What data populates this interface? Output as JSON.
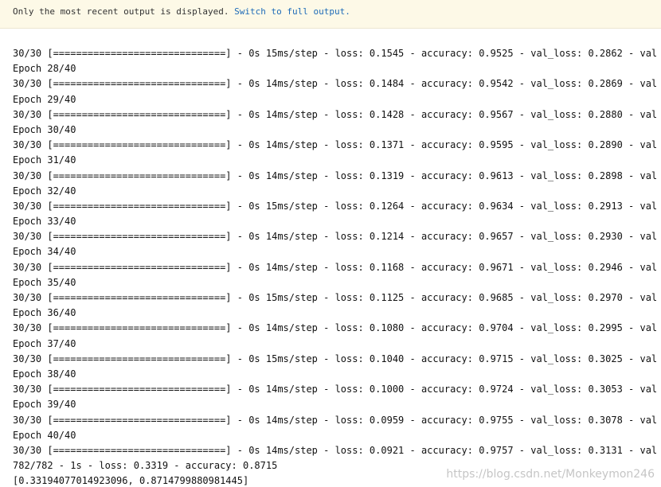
{
  "notice": {
    "text": "Only the most recent output is displayed.",
    "link": "Switch to full output."
  },
  "output": {
    "lines": [
      "30/30 [==============================] - 0s 15ms/step - loss: 0.1545 - accuracy: 0.9525 - val_loss: 0.2862 - val",
      "Epoch 28/40",
      "30/30 [==============================] - 0s 14ms/step - loss: 0.1484 - accuracy: 0.9542 - val_loss: 0.2869 - val",
      "Epoch 29/40",
      "30/30 [==============================] - 0s 14ms/step - loss: 0.1428 - accuracy: 0.9567 - val_loss: 0.2880 - val",
      "Epoch 30/40",
      "30/30 [==============================] - 0s 14ms/step - loss: 0.1371 - accuracy: 0.9595 - val_loss: 0.2890 - val",
      "Epoch 31/40",
      "30/30 [==============================] - 0s 14ms/step - loss: 0.1319 - accuracy: 0.9613 - val_loss: 0.2898 - val",
      "Epoch 32/40",
      "30/30 [==============================] - 0s 15ms/step - loss: 0.1264 - accuracy: 0.9634 - val_loss: 0.2913 - val",
      "Epoch 33/40",
      "30/30 [==============================] - 0s 14ms/step - loss: 0.1214 - accuracy: 0.9657 - val_loss: 0.2930 - val",
      "Epoch 34/40",
      "30/30 [==============================] - 0s 14ms/step - loss: 0.1168 - accuracy: 0.9671 - val_loss: 0.2946 - val",
      "Epoch 35/40",
      "30/30 [==============================] - 0s 15ms/step - loss: 0.1125 - accuracy: 0.9685 - val_loss: 0.2970 - val",
      "Epoch 36/40",
      "30/30 [==============================] - 0s 14ms/step - loss: 0.1080 - accuracy: 0.9704 - val_loss: 0.2995 - val",
      "Epoch 37/40",
      "30/30 [==============================] - 0s 15ms/step - loss: 0.1040 - accuracy: 0.9715 - val_loss: 0.3025 - val",
      "Epoch 38/40",
      "30/30 [==============================] - 0s 14ms/step - loss: 0.1000 - accuracy: 0.9724 - val_loss: 0.3053 - val",
      "Epoch 39/40",
      "30/30 [==============================] - 0s 14ms/step - loss: 0.0959 - accuracy: 0.9755 - val_loss: 0.3078 - val",
      "Epoch 40/40",
      "30/30 [==============================] - 0s 14ms/step - loss: 0.0921 - accuracy: 0.9757 - val_loss: 0.3131 - val",
      "782/782 - 1s - loss: 0.3319 - accuracy: 0.8715",
      "[0.33194077014923096, 0.8714799880981445]"
    ]
  },
  "watermark": "https://blog.csdn.net/Monkeymon246"
}
